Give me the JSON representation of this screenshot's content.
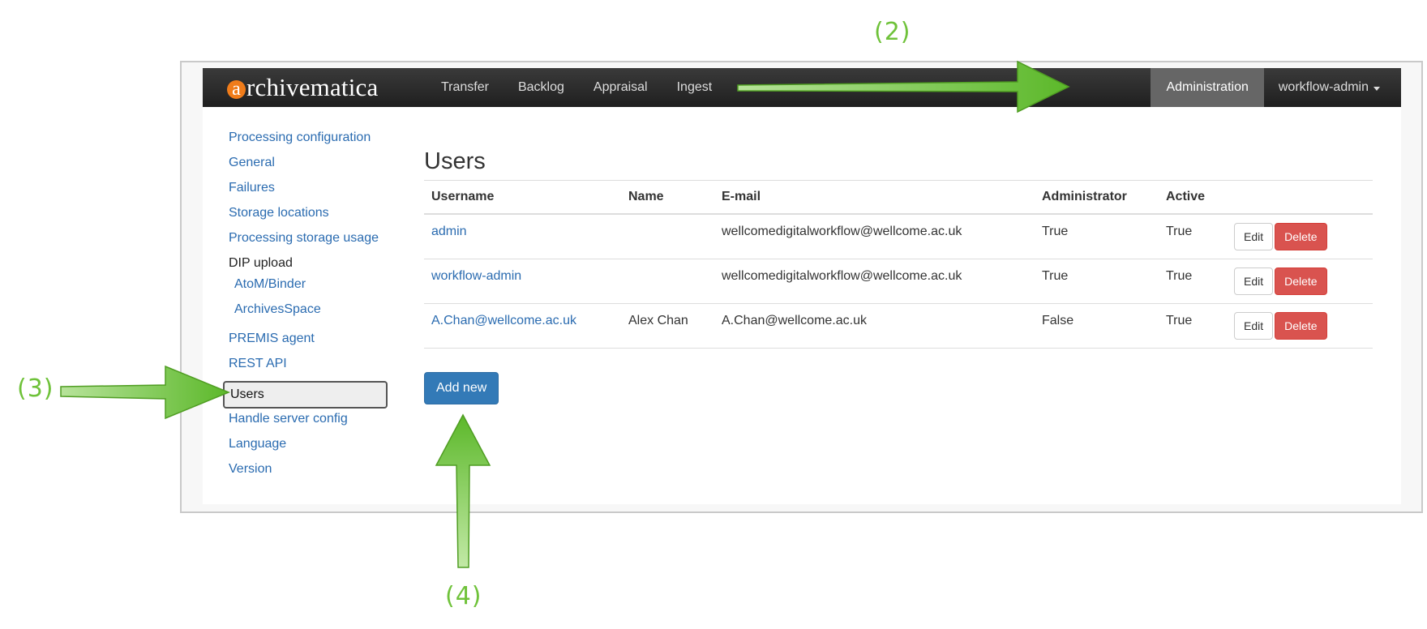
{
  "navbar": {
    "brand": "rchivematica",
    "brand_initial": "a",
    "items": [
      "Transfer",
      "Backlog",
      "Appraisal",
      "Ingest"
    ],
    "admin_label": "Administration",
    "user_label": "workflow-admin"
  },
  "sidebar": {
    "links_top": [
      "Processing configuration",
      "General",
      "Failures",
      "Storage locations",
      "Processing storage usage"
    ],
    "dip_header": "DIP upload",
    "dip_items": [
      "AtoM/Binder",
      "ArchivesSpace"
    ],
    "links_mid": [
      "PREMIS agent",
      "REST API"
    ],
    "active": "Users",
    "links_bottom": [
      "Handle server config",
      "Language",
      "Version"
    ]
  },
  "main": {
    "title": "Users",
    "columns": [
      "Username",
      "Name",
      "E-mail",
      "Administrator",
      "Active"
    ],
    "rows": [
      {
        "username": "admin",
        "name": "",
        "email": "wellcomedigitalworkflow@wellcome.ac.uk",
        "administrator": "True",
        "active": "True"
      },
      {
        "username": "workflow-admin",
        "name": "",
        "email": "wellcomedigitalworkflow@wellcome.ac.uk",
        "administrator": "True",
        "active": "True"
      },
      {
        "username": "A.Chan@wellcome.ac.uk",
        "name": "Alex Chan",
        "email": "A.Chan@wellcome.ac.uk",
        "administrator": "False",
        "active": "True"
      }
    ],
    "edit_label": "Edit",
    "delete_label": "Delete",
    "add_label": "Add new"
  },
  "annotations": {
    "step2": "(2)",
    "step3": "(3)",
    "step4": "(4)",
    "color": "#6fc23a"
  },
  "colors": {
    "navbar": "#2b2b2b",
    "link": "#2a6bb0",
    "primary": "#337ab7",
    "danger": "#d9534f",
    "brand_accent": "#f07c1a"
  }
}
